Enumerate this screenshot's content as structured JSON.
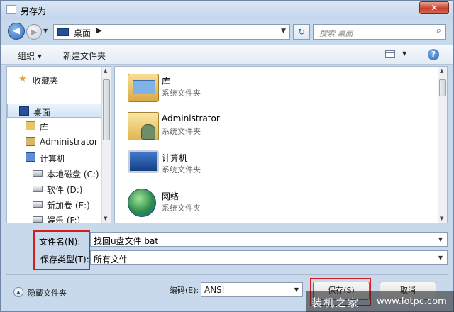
{
  "window": {
    "title": "另存为",
    "close_glyph": "✕"
  },
  "nav": {
    "back_glyph": "◀",
    "forward_glyph": "▶",
    "recent_glyph": "▼",
    "address": {
      "crumb": "桌面",
      "separator": "▶",
      "dropdown_glyph": "▼"
    },
    "refresh_glyph": "↻",
    "search": {
      "placeholder": "搜索 桌面",
      "icon": "search-icon",
      "glyph": "⌕"
    }
  },
  "toolbar": {
    "organize": "组织 ▾",
    "new_folder": "新建文件夹",
    "view_dropdown_glyph": "▼",
    "help_glyph": "?"
  },
  "sidebar": {
    "items": [
      {
        "label": "收藏夹",
        "icon": "star-icon"
      },
      {
        "label": "桌面",
        "icon": "desktop-icon",
        "selected": true
      },
      {
        "label": "库",
        "icon": "library-icon"
      },
      {
        "label": "Administrator",
        "icon": "user-folder-icon"
      },
      {
        "label": "计算机",
        "icon": "computer-icon"
      },
      {
        "label": "本地磁盘 (C:)",
        "icon": "drive-icon"
      },
      {
        "label": "软件 (D:)",
        "icon": "drive-icon"
      },
      {
        "label": "新加卷 (E:)",
        "icon": "drive-icon"
      },
      {
        "label": "娱乐 (F:)",
        "icon": "drive-icon"
      }
    ]
  },
  "files": [
    {
      "name": "库",
      "type": "系统文件夹",
      "icon": "library-icon"
    },
    {
      "name": "Administrator",
      "type": "系统文件夹",
      "icon": "user-folder-icon"
    },
    {
      "name": "计算机",
      "type": "系统文件夹",
      "icon": "computer-icon"
    },
    {
      "name": "网络",
      "type": "系统文件夹",
      "icon": "network-icon"
    }
  ],
  "form": {
    "filename_label": "文件名(N):",
    "filename_value": "找回u盘文件.bat",
    "filetype_label": "保存类型(T):",
    "filetype_value": "所有文件",
    "dropdown_glyph": "▼"
  },
  "footer": {
    "hide_folders": "隐藏文件夹",
    "hide_glyph": "▲",
    "encoding_label": "编码(E):",
    "encoding_value": "ANSI",
    "save": "保存(S)",
    "cancel": "取消"
  },
  "watermark": {
    "name": "装机之家",
    "url": "www.lotpc.com"
  },
  "colors": {
    "highlight_red": "#d21d22",
    "selection_blue": "#d2e4f8"
  }
}
